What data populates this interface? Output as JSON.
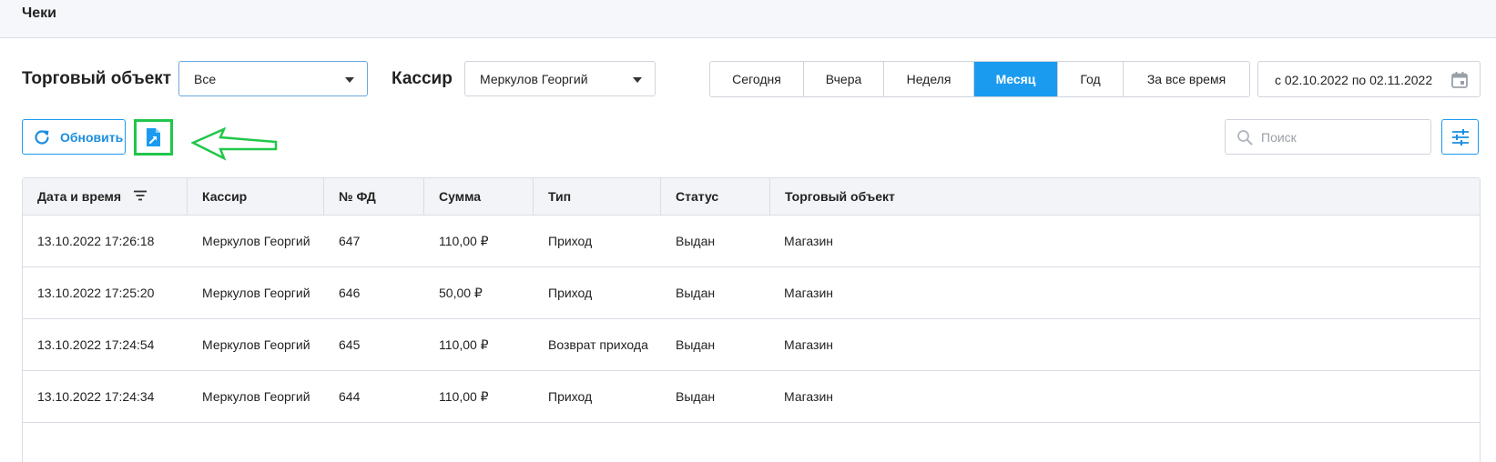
{
  "header": {
    "title": "Чеки"
  },
  "filters": {
    "store_label": "Торговый объект",
    "store_value": "Все",
    "cashier_label": "Кассир",
    "cashier_value": "Меркулов Георгий"
  },
  "periods": [
    {
      "label": "Сегодня",
      "active": false
    },
    {
      "label": "Вчера",
      "active": false
    },
    {
      "label": "Неделя",
      "active": false
    },
    {
      "label": "Месяц",
      "active": true
    },
    {
      "label": "Год",
      "active": false
    },
    {
      "label": "За все время",
      "active": false
    }
  ],
  "daterange": {
    "text": "с 02.10.2022  по 02.11.2022"
  },
  "toolbar": {
    "refresh_label": "Обновить"
  },
  "search": {
    "placeholder": "Поиск"
  },
  "colors": {
    "accent": "#1a9bf0",
    "highlight": "#20c74a"
  },
  "table": {
    "columns": [
      "Дата и время",
      "Кассир",
      "№ ФД",
      "Сумма",
      "Тип",
      "Статус",
      "Торговый объект"
    ],
    "rows": [
      [
        "13.10.2022 17:26:18",
        "Меркулов Георгий",
        "647",
        "110,00 ₽",
        "Приход",
        "Выдан",
        "Магазин"
      ],
      [
        "13.10.2022 17:25:20",
        "Меркулов Георгий",
        "646",
        "50,00 ₽",
        "Приход",
        "Выдан",
        "Магазин"
      ],
      [
        "13.10.2022 17:24:54",
        "Меркулов Георгий",
        "645",
        "110,00 ₽",
        "Возврат прихода",
        "Выдан",
        "Магазин"
      ],
      [
        "13.10.2022 17:24:34",
        "Меркулов Георгий",
        "644",
        "110,00 ₽",
        "Приход",
        "Выдан",
        "Магазин"
      ]
    ]
  }
}
